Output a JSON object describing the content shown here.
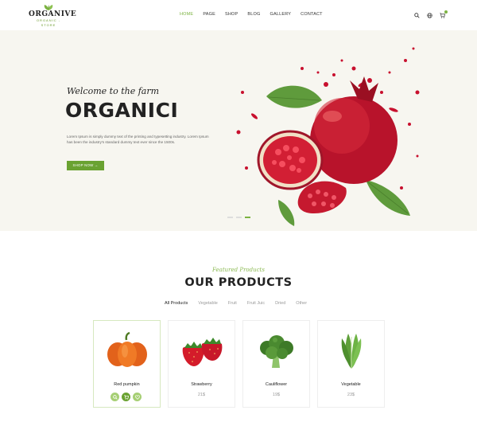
{
  "brand": {
    "name": "ORGANIVE",
    "tagline": "ORGANIC - STORE",
    "accent": "#7cb342",
    "button": "#6aa231"
  },
  "nav": [
    "HOME",
    "PAGE",
    "SHOP",
    "BLOG",
    "GALLERY",
    "CONTACT"
  ],
  "nav_active_index": 0,
  "header_icons": [
    "search-icon",
    "globe-icon",
    "cart-icon"
  ],
  "hero": {
    "welcome": "Welcome to the farm",
    "title": "ORGANICI",
    "description": "Lorem Ipsum is simply dummy text of the printing and typesetting industry. Lorem Ipsum has been the industry's standard dummy text ever since the 1500s.",
    "cta": "SHOP NOW →",
    "slides": 3,
    "active_slide": 3
  },
  "products": {
    "subtitle": "Featured Products",
    "title": "OUR PRODUCTS",
    "filters": [
      "All Products",
      "Vegetable",
      "Fruit",
      "Fruit Juic",
      "Dried",
      "Other"
    ],
    "active_filter": 0,
    "items": [
      {
        "name": "Red pumpkin",
        "price": "",
        "icon": "pumpkin-icon",
        "selected": true
      },
      {
        "name": "Strawberry",
        "price": "21$",
        "icon": "strawberry-icon",
        "selected": false
      },
      {
        "name": "Cauliflower",
        "price": "19$",
        "icon": "broccoli-icon",
        "selected": false
      },
      {
        "name": "Vegetable",
        "price": "23$",
        "icon": "lettuce-icon",
        "selected": false
      }
    ]
  }
}
